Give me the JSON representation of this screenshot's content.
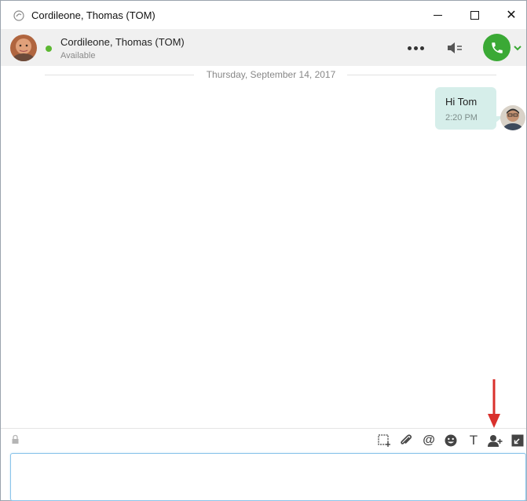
{
  "window": {
    "title": "Cordileone, Thomas (TOM)",
    "minimize_symbol": "—",
    "close_symbol": "✕"
  },
  "contact": {
    "name": "Cordileone, Thomas (TOM)",
    "status": "Available",
    "presence_color": "#5cb832"
  },
  "conversation": {
    "date_separator": "Thursday, September 14, 2017",
    "messages": [
      {
        "text": "Hi Tom",
        "time": "2:20 PM",
        "direction": "outgoing"
      }
    ]
  },
  "toolbar": {
    "icons": [
      "lock-icon",
      "screenshot-icon",
      "attach-icon",
      "mention-icon",
      "emoji-icon",
      "format-text-icon",
      "add-participant-icon",
      "expand-icon"
    ],
    "mention_symbol": "@",
    "format_symbol": "T"
  },
  "compose": {
    "placeholder": "",
    "value": ""
  },
  "colors": {
    "call_button": "#3aa935",
    "bubble": "#d6eeea",
    "annotation_arrow": "#d9302c",
    "input_border": "#8bc4ea"
  }
}
